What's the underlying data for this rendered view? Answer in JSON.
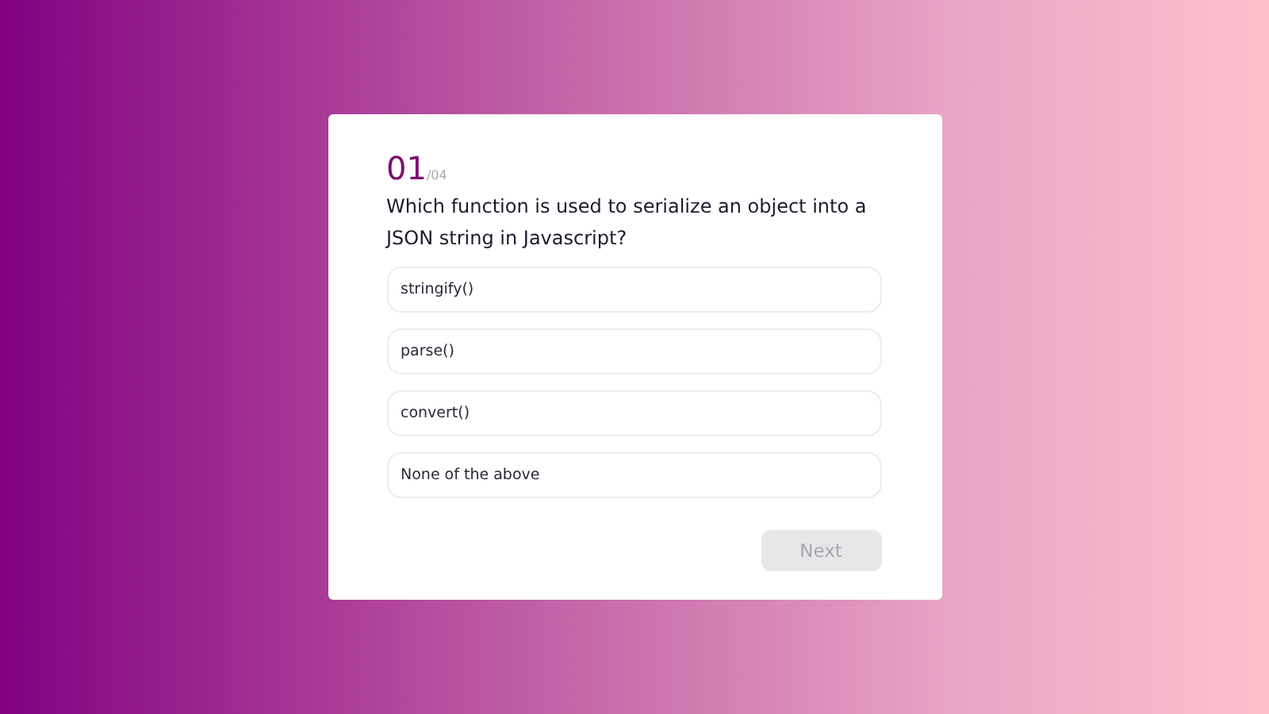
{
  "quiz": {
    "number": "01",
    "total": "/04",
    "question": "Which function is used to serialize an object into a JSON string in Javascript?",
    "options": [
      {
        "label": "stringify()",
        "selected": false
      },
      {
        "label": "parse()",
        "selected": false
      },
      {
        "label": "convert()",
        "selected": false
      },
      {
        "label": "None of the above",
        "selected": false
      }
    ],
    "next_button": {
      "label": "Next",
      "disabled": true
    }
  }
}
